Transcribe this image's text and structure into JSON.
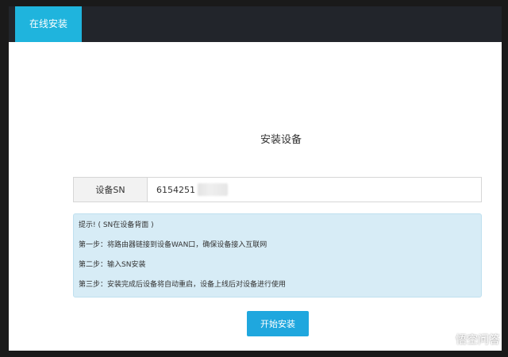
{
  "header": {
    "active_tab_label": "在线安装"
  },
  "main": {
    "title": "安装设备",
    "sn_label": "设备SN",
    "sn_value": "6154251"
  },
  "hint": {
    "lines": [
      "提示! ( SN在设备背面 )",
      "第一步：将路由器链接到设备WAN口，确保设备接入互联网",
      "第二步：输入SN安装",
      "第三步：安装完成后设备将自动重启，设备上线后对设备进行使用"
    ]
  },
  "actions": {
    "install_label": "开始安装"
  },
  "watermark": {
    "text": "悟空问答",
    "icon": "wukong-logo-icon"
  },
  "colors": {
    "accent": "#1fb4dd",
    "button": "#1fa7de",
    "topbar": "#22252b",
    "hint_bg": "#d7ecf6"
  }
}
